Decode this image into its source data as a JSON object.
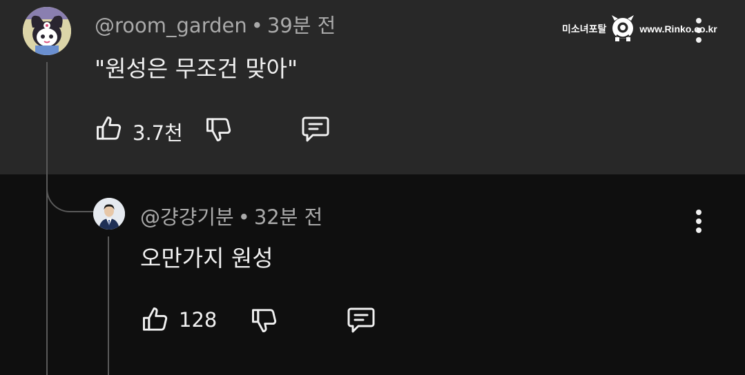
{
  "comments": [
    {
      "handle": "@room_garden",
      "separator": "•",
      "time": "39분 전",
      "text": "\"원성은 무조건 맞아\"",
      "like_count": "3.7천"
    },
    {
      "handle": "@걍걍기분",
      "separator": "•",
      "time": "32분 전",
      "text": "오만가지 원성",
      "like_count": "128"
    }
  ],
  "watermark": {
    "left_text": "미소녀포탈",
    "right_text": "www.Rinko.co.kr"
  },
  "colors": {
    "top_background": "#282828",
    "bottom_background": "#0f0f0f",
    "secondary_text": "#aaaaaa",
    "primary_text": "#f1f1f1",
    "thread_line": "#5a5a5a"
  },
  "icons": [
    "like-icon",
    "dislike-icon",
    "reply-icon",
    "more-vert-icon"
  ]
}
